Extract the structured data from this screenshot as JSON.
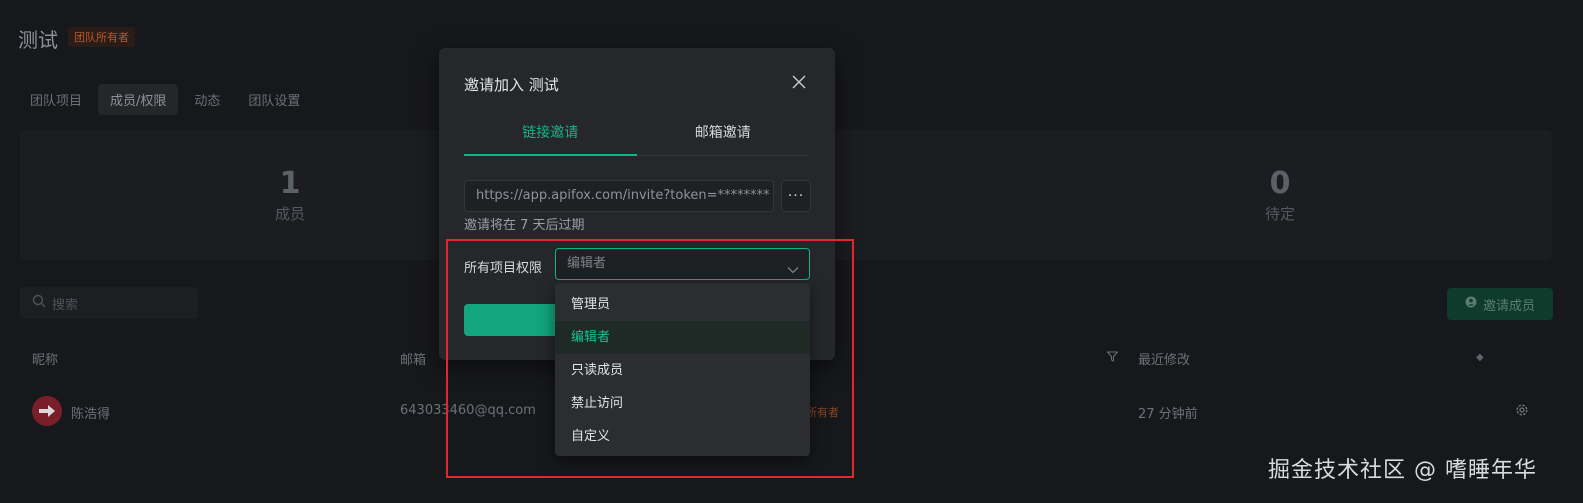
{
  "page": {
    "title": "测试",
    "owner_badge": "团队所有者",
    "tabs": [
      "团队项目",
      "成员/权限",
      "动态",
      "团队设置"
    ],
    "active_tab": "成员/权限",
    "stats": [
      {
        "value": "1",
        "label": "成员"
      },
      {
        "value": "0",
        "label": "待定"
      }
    ],
    "search_placeholder": "搜索",
    "invite_button": "邀请成员",
    "table": {
      "columns": [
        "昵称",
        "邮箱",
        "最近修改"
      ],
      "rows": [
        {
          "name": "陈浩得",
          "email": "643033460@qq.com",
          "role": "所有者",
          "modified": "27 分钟前"
        }
      ]
    }
  },
  "modal": {
    "title": "邀请加入 测试",
    "tabs": [
      "链接邀请",
      "邮箱邀请"
    ],
    "active_tab": "链接邀请",
    "invite_link": "https://app.apifox.com/invite?token=********",
    "more_label": "···",
    "expire_text": "邀请将在 7 天后过期",
    "permission_label": "所有项目权限",
    "permission_value": "编辑者"
  },
  "dropdown": {
    "options": [
      "管理员",
      "编辑者",
      "只读成员",
      "禁止访问",
      "自定义"
    ],
    "selected": "编辑者"
  },
  "watermark": "掘金技术社区 @ 嗜睡年华",
  "colors": {
    "accent": "#12b58a",
    "annotation": "#e0282e",
    "modal_bg": "#25272b",
    "page_bg": "#17181b"
  }
}
